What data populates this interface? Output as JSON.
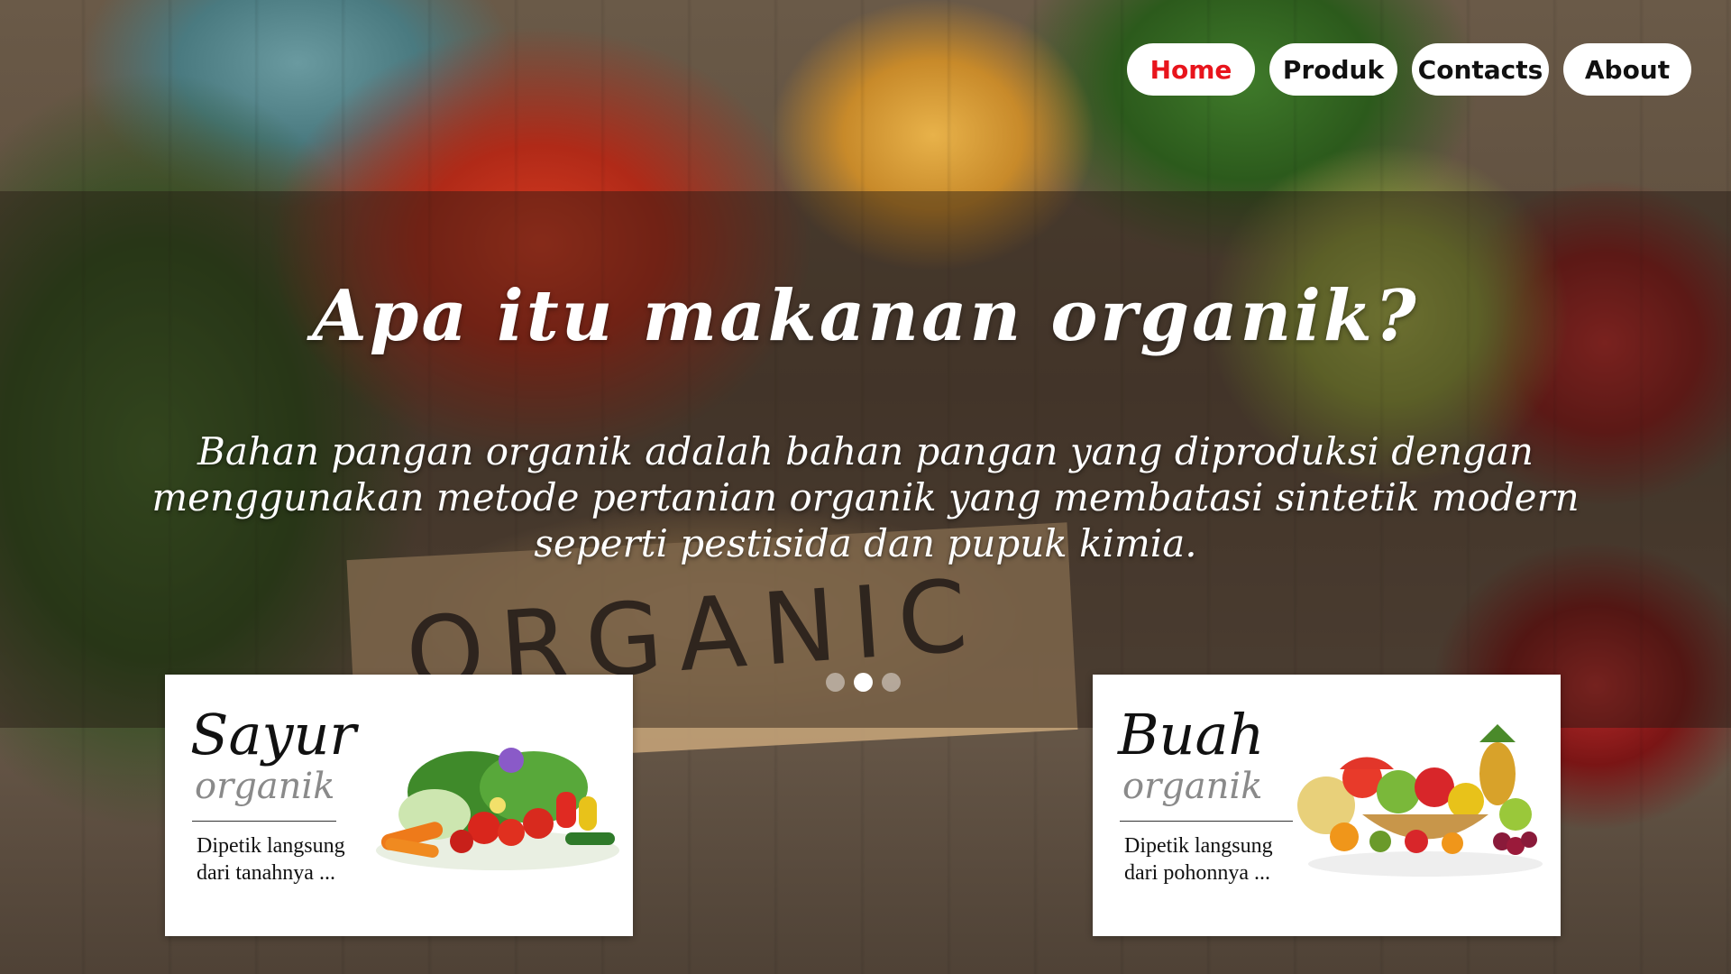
{
  "nav": {
    "items": [
      {
        "label": "Home",
        "active": true
      },
      {
        "label": "Produk",
        "active": false
      },
      {
        "label": "Contacts",
        "active": false
      },
      {
        "label": "About",
        "active": false
      }
    ],
    "active_color": "#e8141c"
  },
  "hero": {
    "title": "Apa itu makanan organik?",
    "text": "Bahan pangan organik adalah bahan pangan yang diproduksi dengan menggunakan metode pertanian organik yang membatasi sintetik modern seperti pestisida dan pupuk kimia.",
    "background_sign_text": "ORGANIC",
    "slides_count": 3,
    "active_slide": 2
  },
  "cards": [
    {
      "title": "Sayur",
      "subtitle": "organik",
      "description": "Dipetik langsung dari tanahnya ...",
      "image": "vegetables-image"
    },
    {
      "title": "Buah",
      "subtitle": "organik",
      "description": "Dipetik langsung dari pohonnya ...",
      "image": "fruit-basket-image"
    }
  ]
}
